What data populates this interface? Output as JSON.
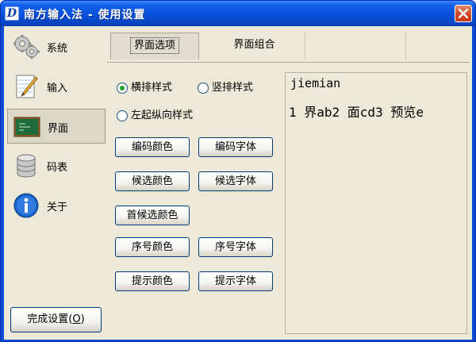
{
  "window": {
    "icon_letter": "D",
    "title": "南方输入法 - 使用设置"
  },
  "sidebar": {
    "items": [
      {
        "label": "系统",
        "icon": "gears-icon"
      },
      {
        "label": "输入",
        "icon": "notepad-pencil-icon"
      },
      {
        "label": "界面",
        "icon": "chalkboard-icon",
        "selected": true
      },
      {
        "label": "码表",
        "icon": "database-icon"
      },
      {
        "label": "关于",
        "icon": "info-icon"
      }
    ],
    "finish_label": "完成设置(",
    "finish_hotkey": "O",
    "finish_label_end": ")"
  },
  "tabs": [
    {
      "label": "界面选项",
      "active": true
    },
    {
      "label": "界面组合",
      "active": false
    }
  ],
  "layout_options": {
    "horizontal": "横排样式",
    "vertical": "竖排样式",
    "left_vertical": "左起纵向样式",
    "selected": "horizontal"
  },
  "buttons": {
    "code_color": "编码颜色",
    "code_font": "编码字体",
    "cand_color": "候选颜色",
    "cand_font": "候选字体",
    "first_cand_color": "首候选颜色",
    "index_color": "序号颜色",
    "index_font": "序号字体",
    "hint_color": "提示颜色",
    "hint_font": "提示字体"
  },
  "preview": {
    "code": "jiemian",
    "candidates": "1 界ab2 面cd3 预览e"
  },
  "colors": {
    "titlebar": "#0a52dc",
    "client_bg": "#ece9d8",
    "radio_dot": "#21a121",
    "close_button": "#d24a25"
  }
}
